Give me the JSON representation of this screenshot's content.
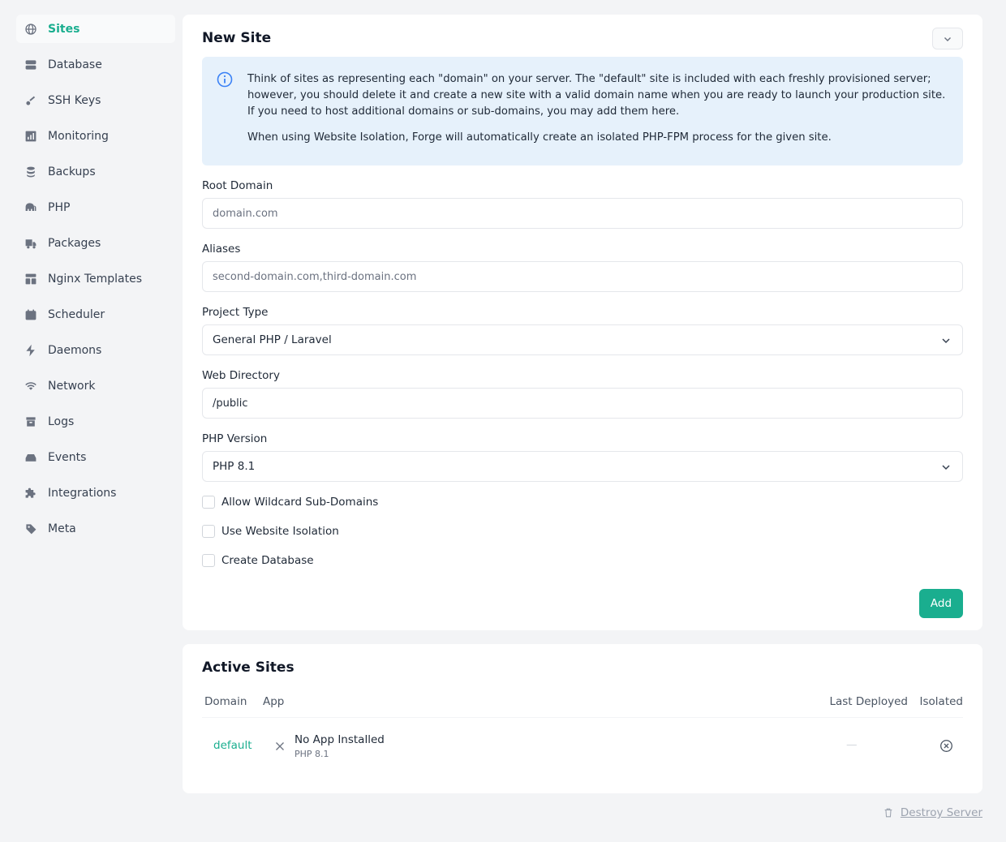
{
  "sidebar": {
    "items": [
      {
        "label": "Sites",
        "icon": "globe-icon"
      },
      {
        "label": "Database",
        "icon": "database-icon"
      },
      {
        "label": "SSH Keys",
        "icon": "key-icon"
      },
      {
        "label": "Monitoring",
        "icon": "chart-icon"
      },
      {
        "label": "Backups",
        "icon": "backup-icon"
      },
      {
        "label": "PHP",
        "icon": "elephant-icon"
      },
      {
        "label": "Packages",
        "icon": "truck-icon"
      },
      {
        "label": "Nginx Templates",
        "icon": "template-icon"
      },
      {
        "label": "Scheduler",
        "icon": "calendar-icon"
      },
      {
        "label": "Daemons",
        "icon": "bolt-icon"
      },
      {
        "label": "Network",
        "icon": "wifi-icon"
      },
      {
        "label": "Logs",
        "icon": "archive-icon"
      },
      {
        "label": "Events",
        "icon": "inbox-icon"
      },
      {
        "label": "Integrations",
        "icon": "puzzle-icon"
      },
      {
        "label": "Meta",
        "icon": "tag-icon"
      }
    ]
  },
  "new_site": {
    "title": "New Site",
    "info_p1": "Think of sites as representing each \"domain\" on your server. The \"default\" site is included with each freshly provisioned server; however, you should delete it and create a new site with a valid domain name when you are ready to launch your production site. If you need to host additional domains or sub-domains, you may add them here.",
    "info_p2": "When using Website Isolation, Forge will automatically create an isolated PHP-FPM process for the given site.",
    "root_domain": {
      "label": "Root Domain",
      "placeholder": "domain.com",
      "value": ""
    },
    "aliases": {
      "label": "Aliases",
      "placeholder": "second-domain.com,third-domain.com",
      "value": ""
    },
    "project_type": {
      "label": "Project Type",
      "selected": "General PHP / Laravel"
    },
    "web_directory": {
      "label": "Web Directory",
      "value": "/public"
    },
    "php_version": {
      "label": "PHP Version",
      "selected": "PHP 8.1"
    },
    "checkboxes": [
      {
        "label": "Allow Wildcard Sub-Domains",
        "checked": false
      },
      {
        "label": "Use Website Isolation",
        "checked": false
      },
      {
        "label": "Create Database",
        "checked": false
      }
    ],
    "add_label": "Add"
  },
  "active_sites": {
    "title": "Active Sites",
    "columns": {
      "domain": "Domain",
      "app": "App",
      "last_deployed": "Last Deployed",
      "isolated": "Isolated"
    },
    "rows": [
      {
        "domain": "default",
        "app": "No App Installed",
        "php": "PHP 8.1",
        "last_deployed": "—",
        "isolated": false
      }
    ]
  },
  "destroy_label": "Destroy Server",
  "colors": {
    "accent": "#1aae8f",
    "info_bg": "#e6f1fb",
    "info_icon": "#3b82f6"
  }
}
